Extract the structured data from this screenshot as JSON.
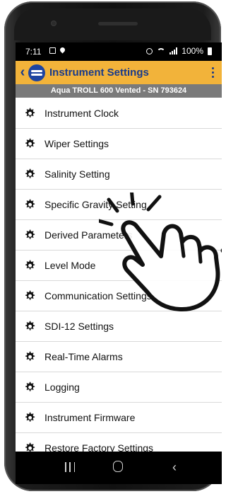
{
  "status_bar": {
    "time": "7:11",
    "battery": "100%"
  },
  "app_bar": {
    "title": "Instrument Settings"
  },
  "sub_header": "Aqua TROLL 600 Vented - SN 793624",
  "settings": [
    {
      "label": "Instrument Clock",
      "icon": "gear-icon"
    },
    {
      "label": "Wiper Settings",
      "icon": "gear-icon"
    },
    {
      "label": "Salinity Setting",
      "icon": "gear-icon"
    },
    {
      "label": "Specific Gravity Setting",
      "icon": "gear-icon"
    },
    {
      "label": "Derived Parameters",
      "icon": "gear-icon"
    },
    {
      "label": "Level Mode",
      "icon": "gear-icon"
    },
    {
      "label": "Communication Settings",
      "icon": "gear-icon"
    },
    {
      "label": "SDI-12 Settings",
      "icon": "gear-icon"
    },
    {
      "label": "Real-Time Alarms",
      "icon": "gear-icon"
    },
    {
      "label": "Logging",
      "icon": "gear-icon"
    },
    {
      "label": "Instrument Firmware",
      "icon": "gear-icon"
    },
    {
      "label": "Restore Factory Settings",
      "icon": "gear-icon"
    }
  ],
  "colors": {
    "app_bar": "#f2b33a",
    "title": "#173a8c",
    "sub_header": "#7a7a7a"
  }
}
